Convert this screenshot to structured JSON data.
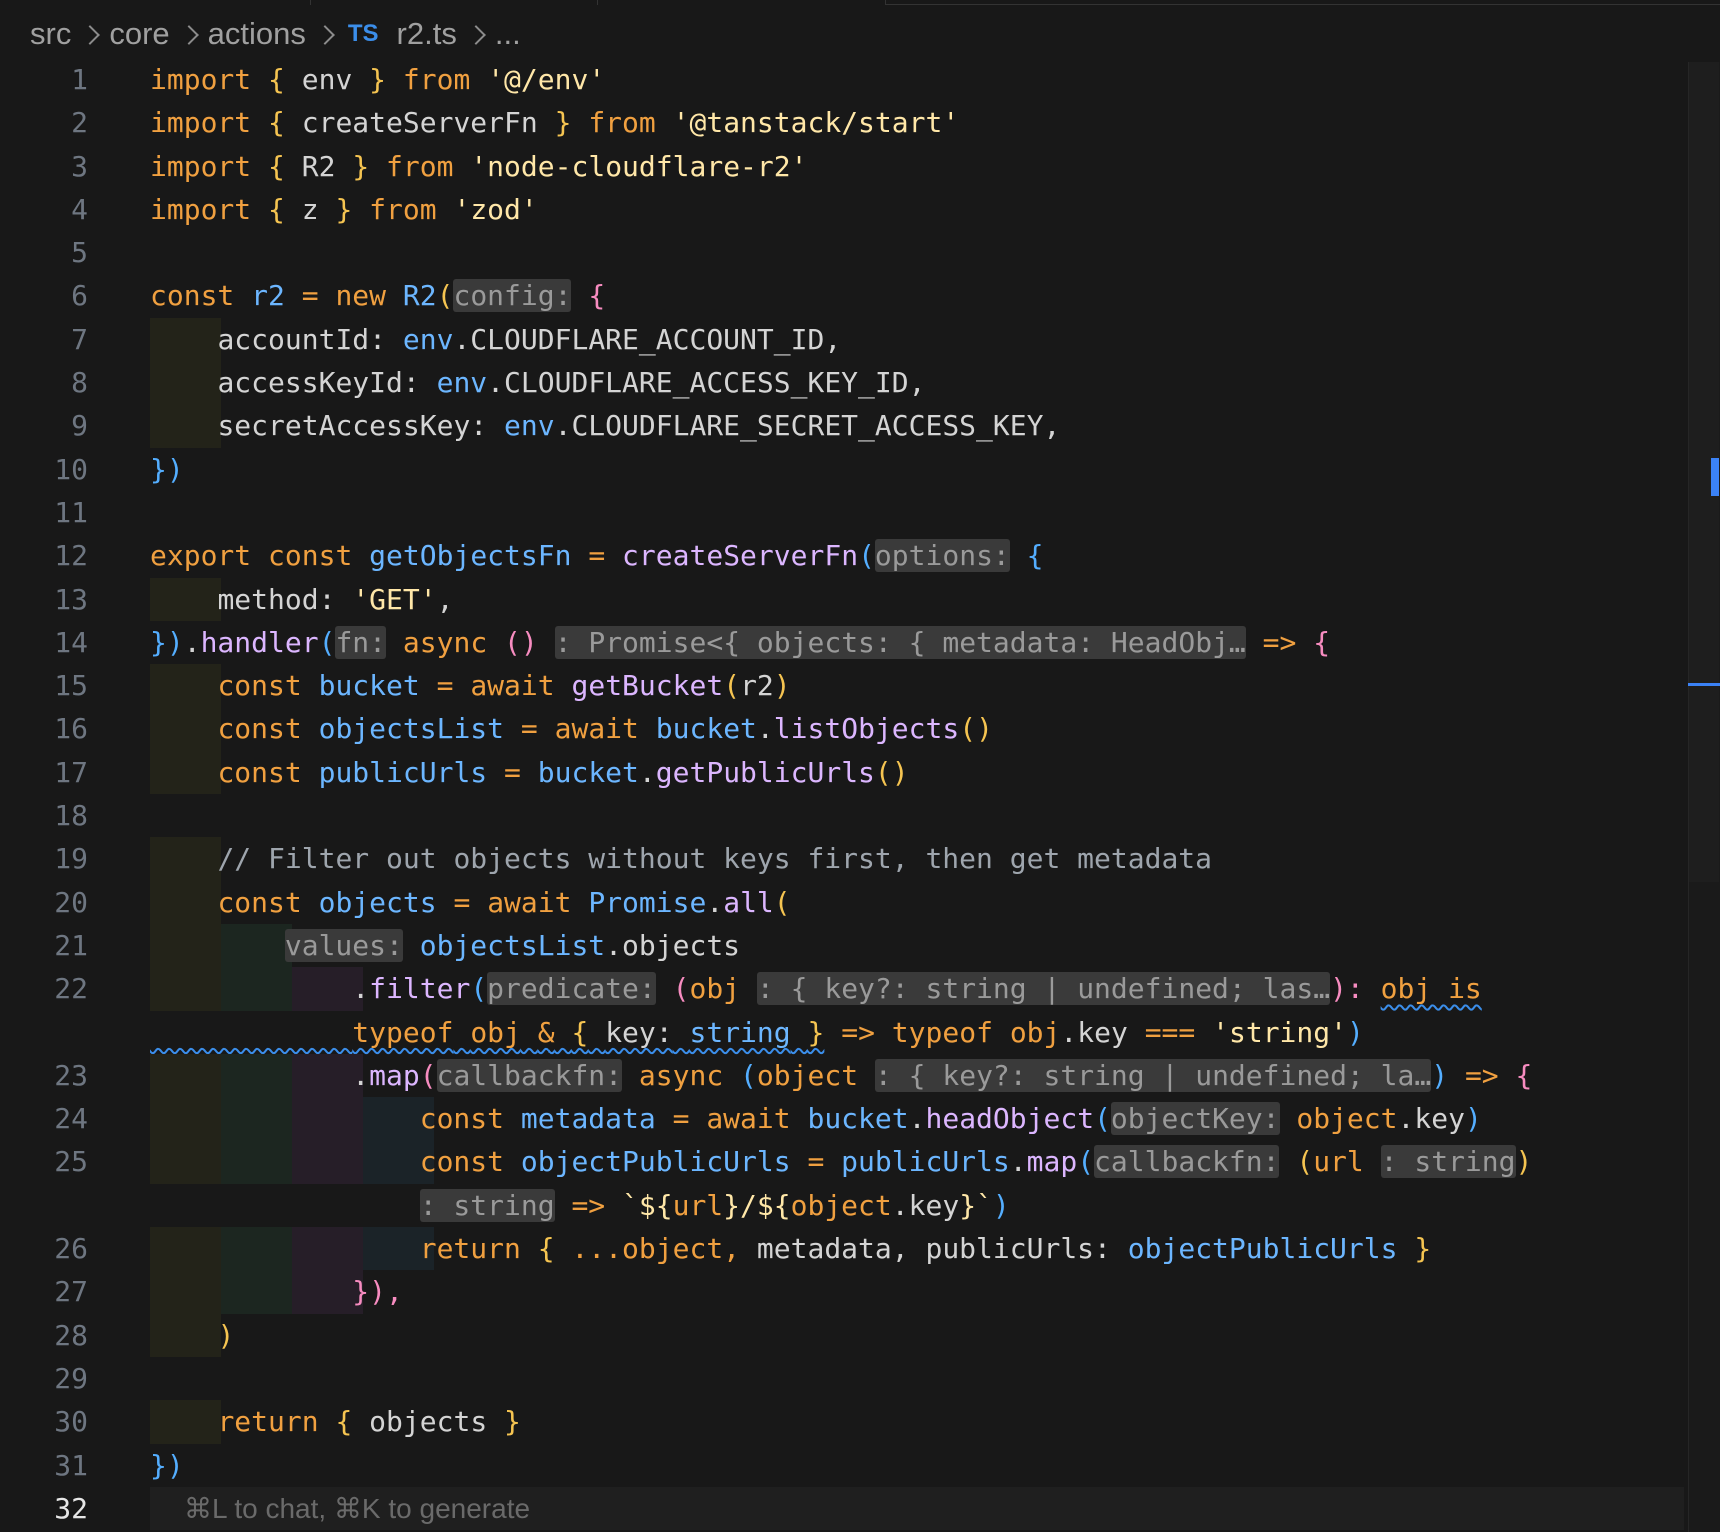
{
  "breadcrumb": {
    "items": [
      "src",
      "core",
      "actions"
    ],
    "file_icon": "TS",
    "file_name": "r2.ts",
    "more": "..."
  },
  "editor": {
    "line_numbers": [
      "1",
      "2",
      "3",
      "4",
      "5",
      "6",
      "7",
      "8",
      "9",
      "10",
      "11",
      "12",
      "13",
      "14",
      "15",
      "16",
      "17",
      "18",
      "19",
      "20",
      "21",
      "22",
      "",
      "23",
      "24",
      "25",
      "",
      "26",
      "27",
      "28",
      "29",
      "30",
      "31",
      "32"
    ],
    "active_line_hint": "⌘L to chat, ⌘K to generate",
    "colors": {
      "keyword": "#f0a040",
      "variable": "#6cb6ff",
      "function": "#dcb6ff",
      "string": "#ffe7a8",
      "inlay_hint_bg": "#3a3a3a",
      "diagnostic_squiggle": "#3b8eea"
    }
  },
  "code": {
    "l1": {
      "kw1": "import",
      "b1": "{",
      "id": "env",
      "b2": "}",
      "kw2": "from",
      "str": "'@/env'"
    },
    "l2": {
      "kw1": "import",
      "b1": "{",
      "id": "createServerFn",
      "b2": "}",
      "kw2": "from",
      "str": "'@tanstack/start'"
    },
    "l3": {
      "kw1": "import",
      "b1": "{",
      "id": "R2",
      "b2": "}",
      "kw2": "from",
      "str": "'node-cloudflare-r2'"
    },
    "l4": {
      "kw1": "import",
      "b1": "{",
      "id": "z",
      "b2": "}",
      "kw2": "from",
      "str": "'zod'"
    },
    "l6": {
      "kw": "const",
      "id": "r2",
      "op": "=",
      "kw2": "new",
      "cls": "R2",
      "paren": "(",
      "hint": "config:",
      "brace": "{"
    },
    "l7": {
      "prop": "accountId:",
      "obj": "env",
      "rest": ".CLOUDFLARE_ACCOUNT_ID,"
    },
    "l8": {
      "prop": "accessKeyId:",
      "obj": "env",
      "rest": ".CLOUDFLARE_ACCESS_KEY_ID,"
    },
    "l9": {
      "prop": "secretAccessKey:",
      "obj": "env",
      "rest": ".CLOUDFLARE_SECRET_ACCESS_KEY,"
    },
    "l10": {
      "close": "})"
    },
    "l12": {
      "kw1": "export",
      "kw2": "const",
      "id": "getObjectsFn",
      "op": "=",
      "fn": "createServerFn",
      "paren": "(",
      "hint": "options:",
      "brace": "{"
    },
    "l13": {
      "prop": "method:",
      "str": "'GET'",
      "comma": ","
    },
    "l14": {
      "close": "})",
      "dot": ".",
      "fn": "handler",
      "paren": "(",
      "hint": "fn:",
      "kw": "async",
      "args": "()",
      "ret_hint": ": Promise<{ objects: { metadata: HeadObj…",
      "arrow": "=>",
      "brace": "{"
    },
    "l15": {
      "kw": "const",
      "id": "bucket",
      "op": "=",
      "kw2": "await",
      "fn": "getBucket",
      "paren1": "(",
      "arg": "r2",
      "paren2": ")"
    },
    "l16": {
      "kw": "const",
      "id": "objectsList",
      "op": "=",
      "kw2": "await",
      "obj": "bucket",
      "dot": ".",
      "fn": "listObjects",
      "parens": "()"
    },
    "l17": {
      "kw": "const",
      "id": "publicUrls",
      "op": "=",
      "obj": "bucket",
      "dot": ".",
      "fn": "getPublicUrls",
      "parens": "()"
    },
    "l19": {
      "comment": "// Filter out objects without keys first, then get metadata"
    },
    "l20": {
      "kw": "const",
      "id": "objects",
      "op": "=",
      "kw2": "await",
      "cls": "Promise",
      "dot": ".",
      "fn": "all",
      "paren": "("
    },
    "l21": {
      "hint": "values:",
      "obj": "objectsList",
      "rest": ".objects"
    },
    "l22": {
      "dot": ".",
      "fn": "filter",
      "paren": "(",
      "hint": "predicate:",
      "p2": "(",
      "param": "obj",
      "type_hint": ": { key?: string | undefined; las…",
      "close": "):",
      "pred": "obj is"
    },
    "l22b": {
      "kw": "typeof",
      "id": "obj",
      "amp": "&",
      "b": "{",
      "prop": "key:",
      "type": "string",
      "b2": "}",
      "arrow": "=>",
      "kw2": "typeof",
      "obj": "obj",
      "rest": ".key",
      "op": "===",
      "str": "'string'",
      "close": ")"
    },
    "l23": {
      "dot": ".",
      "fn": "map",
      "paren": "(",
      "hint": "callbackfn:",
      "kw": "async",
      "p2": "(",
      "param": "object",
      "type_hint": ": { key?: string | undefined; la…",
      "close": ")",
      "arrow": "=>",
      "brace": "{"
    },
    "l24": {
      "kw": "const",
      "id": "metadata",
      "op": "=",
      "kw2": "await",
      "obj": "bucket",
      "dot": ".",
      "fn": "headObject",
      "paren": "(",
      "hint": "objectKey:",
      "arg": "object",
      "rest": ".key",
      "close": ")"
    },
    "l25": {
      "kw": "const",
      "id": "objectPublicUrls",
      "op": "=",
      "obj": "publicUrls",
      "dot": ".",
      "fn": "map",
      "paren": "(",
      "hint": "callbackfn:",
      "p2": "(",
      "param": "url",
      "type_hint": ": string",
      "close": ")"
    },
    "l25b": {
      "ret_hint": ": string",
      "arrow": "=>",
      "tmpl_start": "`${",
      "v1": "url",
      "mid": "}/${",
      "v2": "object",
      "v2rest": ".key",
      "tmpl_end": "}`",
      "close": ")"
    },
    "l26": {
      "kw": "return",
      "b": "{",
      "spread": "...object,",
      "m": "metadata,",
      "prop": "publicUrls:",
      "id": "objectPublicUrls",
      "b2": "}"
    },
    "l27": {
      "close": "}),"
    },
    "l28": {
      "close": ")"
    },
    "l30": {
      "kw": "return",
      "b": "{",
      "id": "objects",
      "b2": "}"
    },
    "l31": {
      "close": "})"
    }
  }
}
